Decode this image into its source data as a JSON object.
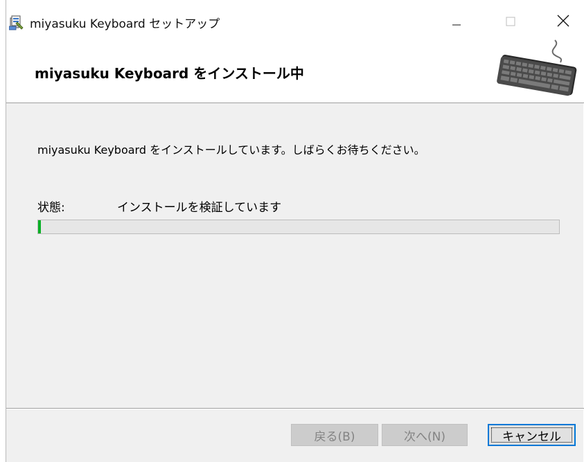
{
  "window": {
    "title": "miyasuku Keyboard セットアップ"
  },
  "titlebar_buttons": {
    "minimize_icon": "minimize-icon",
    "maximize_icon": "maximize-icon",
    "close_icon": "close-icon"
  },
  "banner": {
    "title": "miyasuku Keyboard をインストール中",
    "image": "keyboard-illustration"
  },
  "body": {
    "message": "miyasuku Keyboard をインストールしています。しばらくお待ちください。",
    "status_label": "状態:",
    "status_value": "インストールを検証しています",
    "progress": 0.005
  },
  "footer": {
    "back_label": "戻る(B)",
    "next_label": "次へ(N)",
    "cancel_label": "キャンセル"
  },
  "colors": {
    "progress_fill": "#06b025",
    "accent": "#0078d7"
  }
}
